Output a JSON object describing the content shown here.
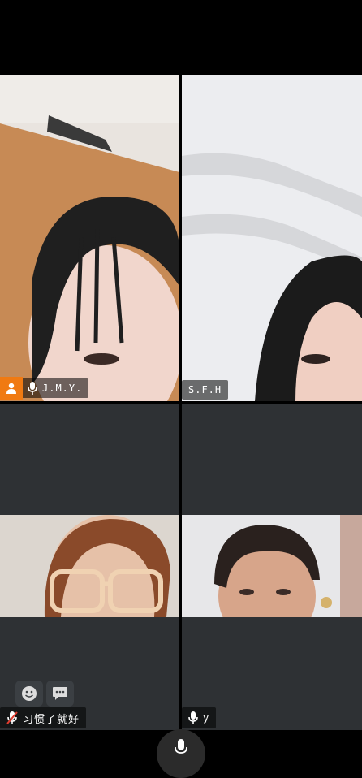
{
  "participants": [
    {
      "name": "J.M.Y.",
      "is_host": true,
      "mic": "on"
    },
    {
      "name": "S.F.H",
      "is_host": false,
      "mic": "none"
    },
    {
      "name": "习惯了就好",
      "is_host": false,
      "mic": "muted"
    },
    {
      "name": "y",
      "is_host": false,
      "mic": "on"
    }
  ],
  "controls": {
    "emoji_icon": "smile-icon",
    "chat_icon": "chat-bubble-icon",
    "bottom_mic_icon": "microphone-icon"
  },
  "colors": {
    "host_badge": "#f07a12",
    "tile_background": "#2e3134",
    "muted_slash": "#e23b2e"
  }
}
